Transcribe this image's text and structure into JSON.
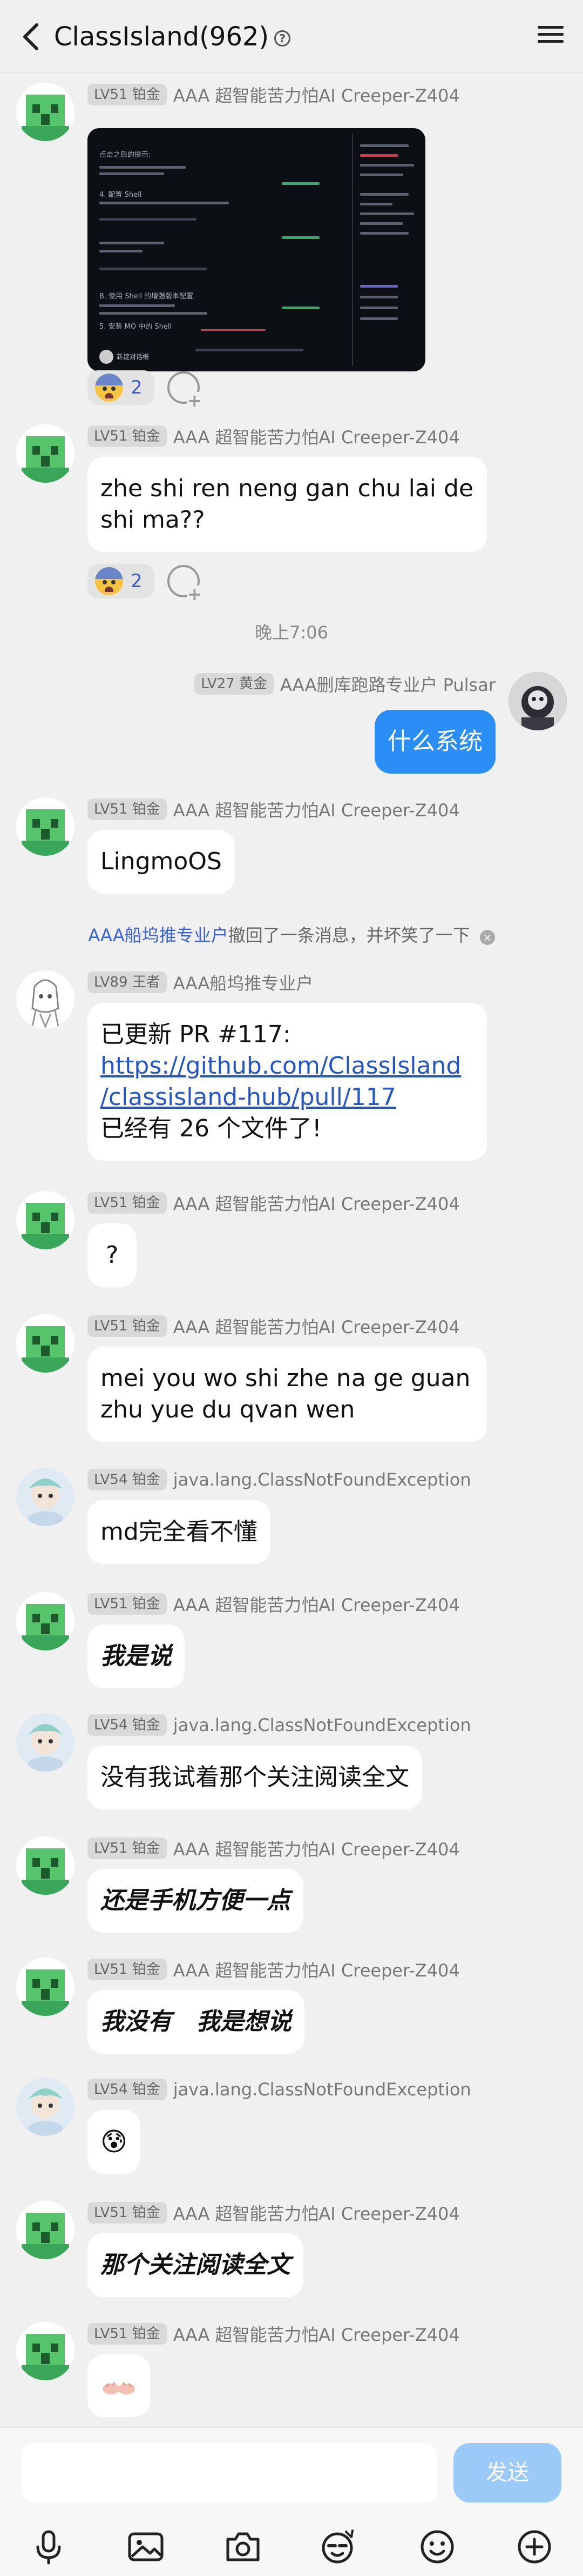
{
  "header": {
    "title": "ClassIsland(962)",
    "help_glyph": "?"
  },
  "messages": {
    "m1": {
      "level": "LV51 铂金",
      "user": "AAA 超智能苦力怕AI Creeper-Z404",
      "screenshot": {
        "t1": "点击之后的提示:",
        "t2": "4. 配置 Shell",
        "t3": "B. 使用 Shell 的增强版本配置",
        "t4": "5. 安装 MO 中的 Shell",
        "caption": "新建对话框"
      }
    },
    "r1": {
      "count": "2"
    },
    "m2": {
      "level": "LV51 铂金",
      "user": "AAA 超智能苦力怕AI Creeper-Z404",
      "text": "zhe shi ren neng gan chu lai de shi ma??"
    },
    "r2": {
      "count": "2"
    },
    "time": "晚上7:06",
    "m3": {
      "level": "LV27 黄金",
      "user": "AAA删库跑路专业户 Pulsar",
      "text": "什么系统"
    },
    "m4": {
      "level": "LV51 铂金",
      "user": "AAA 超智能苦力怕AI Creeper-Z404",
      "text": "LingmoOS"
    },
    "sys": {
      "who": "AAA船坞推专业户",
      "text": "撤回了一条消息，并坏笑了一下",
      "close": "×"
    },
    "m5": {
      "level": "LV89 王者",
      "user": "AAA船坞推专业户",
      "line1": "已更新 PR #117:",
      "link1": "https://github.com/ClassIsland",
      "link2": "/classisland-hub/pull/117",
      "line3": "已经有 26 个文件了!"
    },
    "m6": {
      "level": "LV51 铂金",
      "user": "AAA 超智能苦力怕AI Creeper-Z404",
      "text": "?"
    },
    "m7": {
      "level": "LV51 铂金",
      "user": "AAA 超智能苦力怕AI Creeper-Z404",
      "text": "mei you wo shi zhe na ge guan zhu yue du qvan wen"
    },
    "m8": {
      "level": "LV54 铂金",
      "user": "java.lang.ClassNotFoundException",
      "text": "md完全看不懂"
    },
    "m9": {
      "level": "LV51 铂金",
      "user": "AAA 超智能苦力怕AI Creeper-Z404",
      "text": "我是说"
    },
    "m10": {
      "level": "LV54 铂金",
      "user": "java.lang.ClassNotFoundException",
      "text": "没有我试着那个关注阅读全文"
    },
    "m11": {
      "level": "LV51 铂金",
      "user": "AAA 超智能苦力怕AI Creeper-Z404",
      "text": "还是手机方便一点"
    },
    "m12": {
      "level": "LV51 铂金",
      "user": "AAA 超智能苦力怕AI Creeper-Z404",
      "text": "我没有   我是想说"
    },
    "m13": {
      "level": "LV54 铂金",
      "user": "java.lang.ClassNotFoundException",
      "text": "😰"
    },
    "m14": {
      "level": "LV51 铂金",
      "user": "AAA 超智能苦力怕AI Creeper-Z404",
      "text": "那个关注阅读全文"
    },
    "m15": {
      "level": "LV51 铂金",
      "user": "AAA 超智能苦力怕AI Creeper-Z404"
    }
  },
  "compose": {
    "placeholder": "",
    "send": "发送"
  },
  "toolbar": [
    "mic-icon",
    "image-icon",
    "camera-icon",
    "sticker-icon",
    "emoji-icon",
    "plus-icon"
  ],
  "colors": {
    "accent": "#2b8ef7",
    "send_disabled": "#9ccaf8",
    "link": "#2456c8",
    "bg": "#f0f0f0"
  }
}
